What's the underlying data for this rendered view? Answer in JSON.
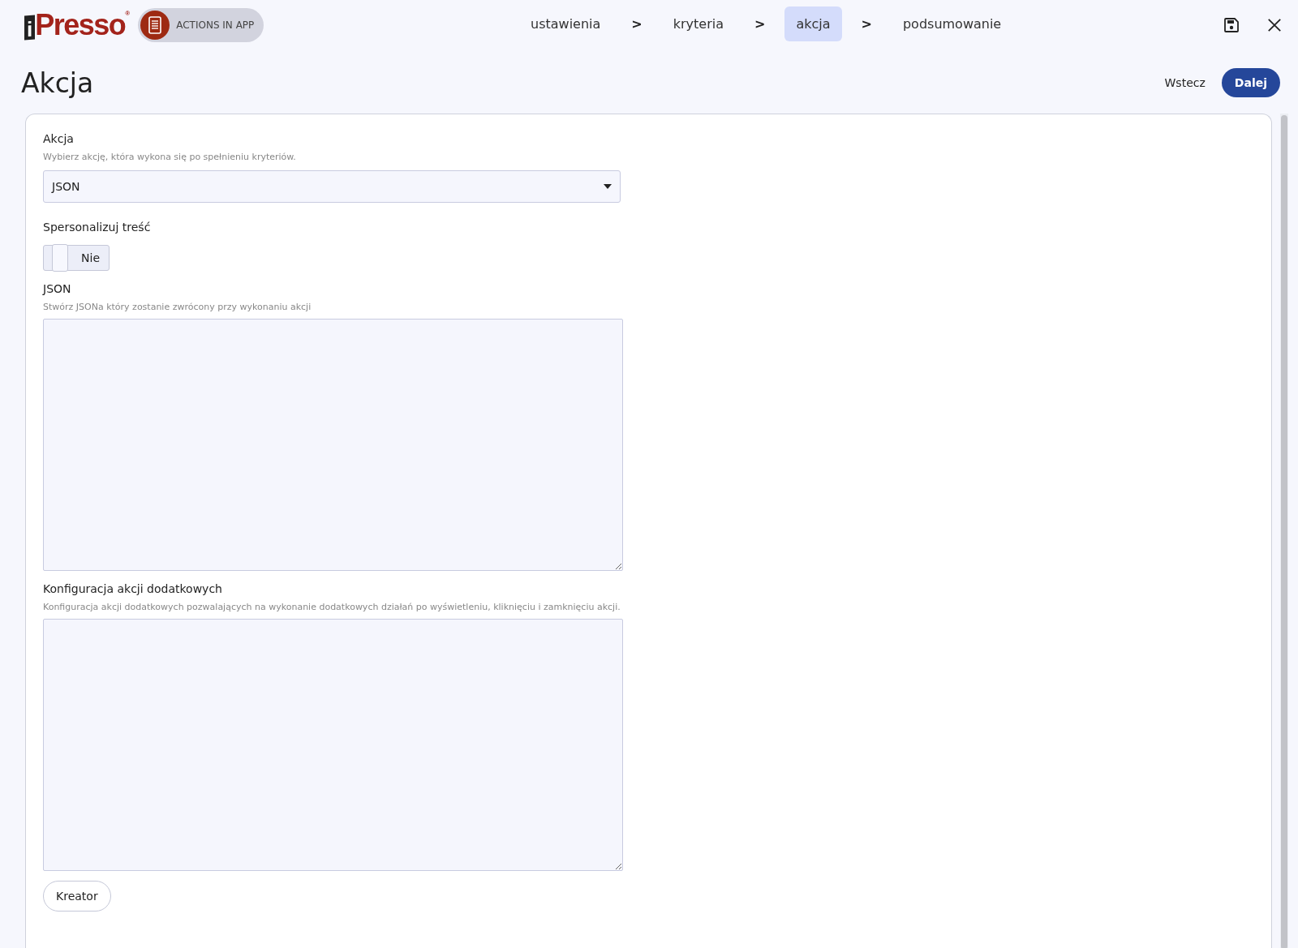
{
  "header": {
    "logo": {
      "letter": "i",
      "name": "Presso",
      "mark": "®"
    },
    "module_badge": "ACTIONS IN APP",
    "steps": [
      {
        "label": "ustawienia",
        "selected": false
      },
      {
        "label": "kryteria",
        "selected": false
      },
      {
        "label": "akcja",
        "selected": true
      },
      {
        "label": "podsumowanie",
        "selected": false
      }
    ],
    "separator": ">"
  },
  "page": {
    "title": "Akcja",
    "back_button": "Wstecz",
    "next_button": "Dalej"
  },
  "form": {
    "action": {
      "label": "Akcja",
      "hint": "Wybierz akcję, która wykona się po spełnieniu kryteriów.",
      "value": "JSON"
    },
    "personalize": {
      "label": "Spersonalizuj treść",
      "on": false,
      "state_label": "Nie"
    },
    "json": {
      "label": "JSON",
      "hint": "Stwórz JSONa który zostanie zwrócony przy wykonaniu akcji"
    },
    "extra": {
      "label": "Konfiguracja akcji dodatkowych",
      "hint": "Konfiguracja akcji dodatkowych pozwalających na wykonanie dodatkowych działań po wyświetleniu, kliknięciu i zamknięciu akcji."
    },
    "creator_button": "Kreator"
  }
}
